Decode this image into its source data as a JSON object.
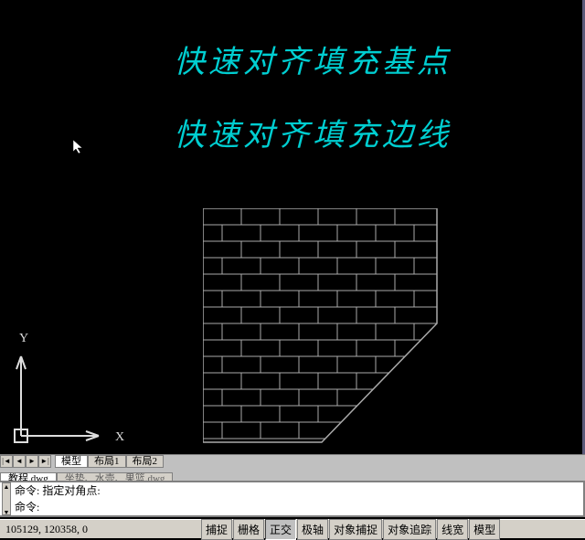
{
  "canvas": {
    "title1": "快速对齐填充基点",
    "title2": "快速对齐填充边线",
    "ucs_y": "Y",
    "ucs_x": "X"
  },
  "nav": {
    "first": "|◄",
    "prev": "◄",
    "next": "►",
    "last": "►|"
  },
  "layout_tabs": [
    "模型",
    "布局1",
    "布局2"
  ],
  "file_tabs": [
    "教程.dwg",
    "坐垫、水壶、果篮.dwg"
  ],
  "cmd": {
    "line1": "命令: 指定对角点:",
    "line2": "命令:"
  },
  "status": {
    "coords": "105129, 120358, 0",
    "buttons": [
      "捕捉",
      "栅格",
      "正交",
      "极轴",
      "对象捕捉",
      "对象追踪",
      "线宽",
      "模型"
    ]
  }
}
